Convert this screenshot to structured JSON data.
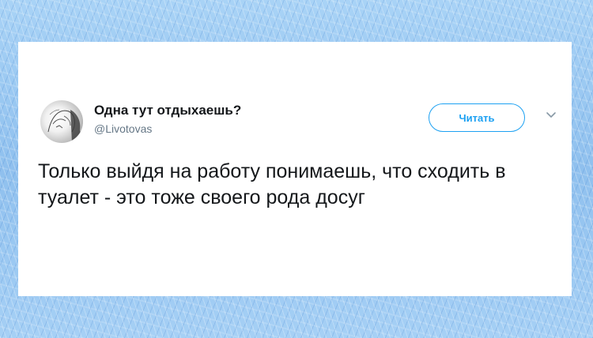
{
  "tweet": {
    "display_name": "Одна тут отдыхаешь?",
    "handle": "@Livotovas",
    "follow_label": "Читать",
    "text": "Только выйдя на работу понимаешь, что сходить в туалет - это тоже своего рода досуг"
  },
  "icons": {
    "avatar": "sketch-face-avatar",
    "more": "chevron-down-icon"
  },
  "colors": {
    "accent": "#1da1f2",
    "text": "#14171a",
    "secondary_text": "#657786",
    "card_bg": "#ffffff",
    "page_bg": "#9cc8f0"
  }
}
